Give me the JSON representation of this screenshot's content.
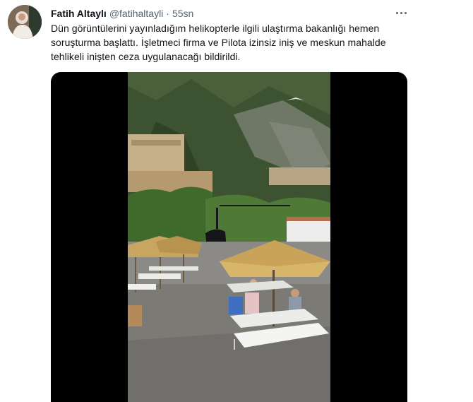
{
  "tweet": {
    "author_name": "Fatih Altaylı",
    "author_handle": "@fatihaltayli",
    "separator": "·",
    "time": "55sn",
    "text_lines": [
      "Dün görüntülerini yayınladığım helikopterle ilgili ulaştırma bakanlığı hemen",
      "soruşturma başlattı. İşletmeci firma ve Pilota izinsiz iniş ve meskun mahalde",
      "tehlikeli inişten ceza uygulanacağı bildirildi."
    ]
  },
  "icons": {
    "more": "more-horizontal-icon"
  },
  "colors": {
    "text": "#0f1419",
    "secondary": "#536471",
    "media_background": "#000000"
  }
}
